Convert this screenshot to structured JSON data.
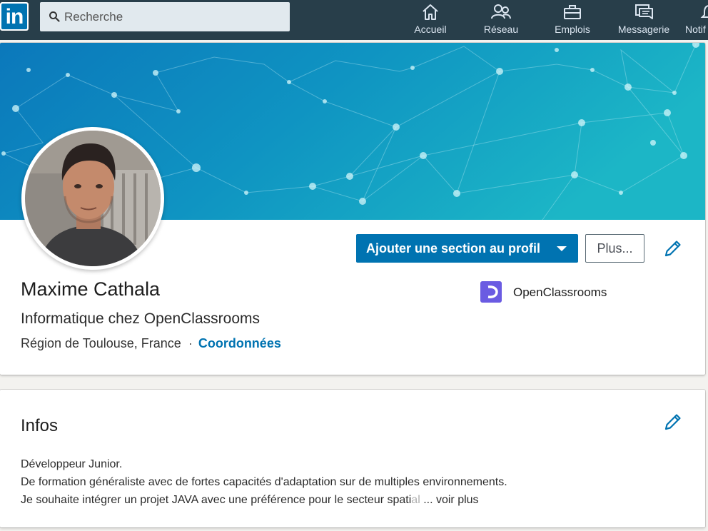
{
  "nav": {
    "logo_text": "in",
    "search_placeholder": "Recherche",
    "items": [
      {
        "label": "Accueil",
        "icon": "home-icon"
      },
      {
        "label": "Réseau",
        "icon": "network-icon"
      },
      {
        "label": "Emplois",
        "icon": "briefcase-icon"
      },
      {
        "label": "Messagerie",
        "icon": "messaging-icon"
      },
      {
        "label": "Notif",
        "icon": "bell-icon"
      }
    ]
  },
  "profile": {
    "name": "Maxime Cathala",
    "headline": "Informatique chez OpenClassrooms",
    "location": "Région de Toulouse, France",
    "separator": "·",
    "contact_link": "Coordonnées",
    "add_section_button": "Ajouter une section au profil",
    "more_button": "Plus...",
    "company": "OpenClassrooms"
  },
  "about": {
    "title": "Infos",
    "line1": "Développeur Junior.",
    "line2": "De formation généraliste avec de fortes capacités d'adaptation sur de multiples environnements.",
    "line3_main": "Je souhaite intégrer un projet JAVA avec une préférence pour le secteur spati",
    "line3_faded": "al",
    "see_more": " ... voir plus"
  },
  "colors": {
    "nav_bg": "#283e4a",
    "primary": "#0073b1",
    "banner_start": "#0b7fbd",
    "banner_end": "#1ab3c4",
    "company_logo": "#6a5be2"
  }
}
